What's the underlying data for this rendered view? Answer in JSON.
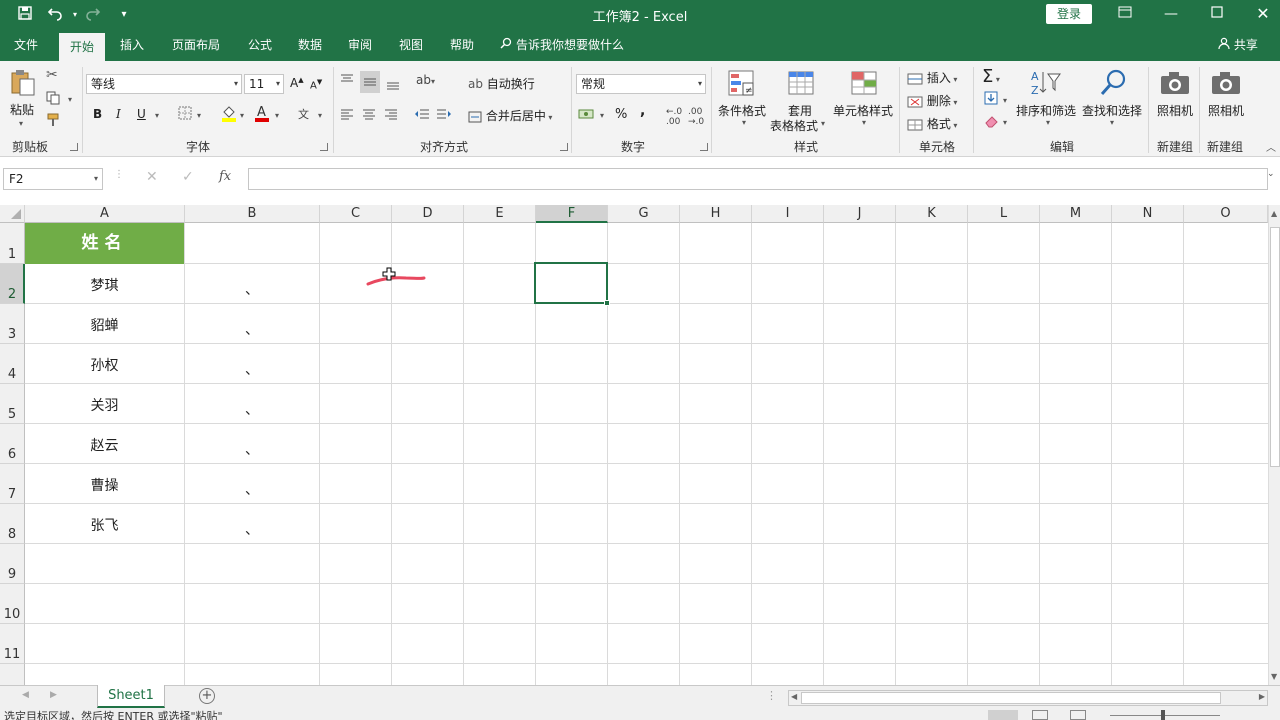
{
  "window": {
    "title": "工作簿2  -  Excel",
    "login_label": "登录"
  },
  "tabs": [
    {
      "label": "文件"
    },
    {
      "label": "开始"
    },
    {
      "label": "插入"
    },
    {
      "label": "页面布局"
    },
    {
      "label": "公式"
    },
    {
      "label": "数据"
    },
    {
      "label": "审阅"
    },
    {
      "label": "视图"
    },
    {
      "label": "帮助"
    }
  ],
  "tell_me": "告诉我你想要做什么",
  "share_label": "共享",
  "ribbon": {
    "clipboard": {
      "paste": "粘贴",
      "group": "剪贴板"
    },
    "font": {
      "name": "等线",
      "size": "11",
      "bold": "B",
      "italic": "I",
      "underline": "U",
      "group": "字体"
    },
    "alignment": {
      "wrap_text": "自动换行",
      "merge_center": "合并后居中",
      "group": "对齐方式"
    },
    "number": {
      "format": "常规",
      "percent": "%",
      "comma": ",",
      "group": "数字"
    },
    "styles": {
      "conditional": "条件格式",
      "format_table_1": "套用",
      "format_table_2": "表格格式",
      "cell_styles": "单元格样式",
      "group": "样式"
    },
    "cells": {
      "insert": "插入",
      "delete": "删除",
      "format": "格式",
      "group": "单元格"
    },
    "editing": {
      "sort_filter": "排序和筛选",
      "find_select": "查找和选择",
      "group": "编辑"
    },
    "camera1": {
      "label": "照相机",
      "group": "新建组"
    },
    "camera2": {
      "label": "照相机",
      "group": "新建组"
    }
  },
  "formula_bar": {
    "name_box": "F2",
    "formula": ""
  },
  "columns": [
    "A",
    "B",
    "C",
    "D",
    "E",
    "F",
    "G",
    "H",
    "I",
    "J",
    "K",
    "L",
    "M",
    "N",
    "O"
  ],
  "rows": [
    "1",
    "2",
    "3",
    "4",
    "5",
    "6",
    "7",
    "8",
    "9",
    "10",
    "11"
  ],
  "sheet": {
    "header_a1": "姓名",
    "names": [
      "梦琪",
      "貂蝉",
      "孙权",
      "关羽",
      "赵云",
      "曹操",
      "张飞"
    ],
    "marks_b": [
      "、",
      "、",
      "、",
      "、",
      "、",
      "、",
      "、"
    ],
    "selected_cell": "F2"
  },
  "sheet_tabs": [
    {
      "label": "Sheet1"
    }
  ],
  "status": {
    "message": "选定目标区域，然后按 ENTER 或选择\"粘贴\""
  },
  "colors": {
    "accent": "#217346",
    "header_fill": "#70ad47"
  }
}
